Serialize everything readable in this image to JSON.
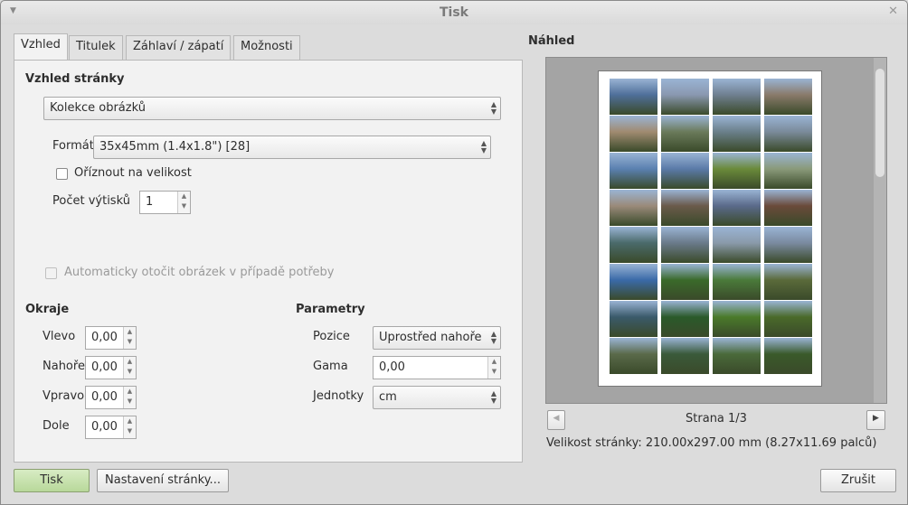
{
  "window": {
    "title": "Tisk"
  },
  "tabs": [
    {
      "label": "Vzhled"
    },
    {
      "label": "Titulek"
    },
    {
      "label": "Záhlaví / zápatí"
    },
    {
      "label": "Možnosti"
    }
  ],
  "layout": {
    "section_title": "Vzhled stránky",
    "layout_type": "Kolekce obrázků",
    "format_label": "Formát",
    "format_value": "35x45mm (1.4x1.8\") [28]",
    "crop_label": "Oříznout na velikost",
    "crop_checked": false,
    "copies_label": "Počet výtisků",
    "copies_value": "1",
    "autorotate_label": "Automaticky otočit obrázek v případě potřeby"
  },
  "margins": {
    "title": "Okraje",
    "items": [
      {
        "label": "Vlevo",
        "value": "0,00"
      },
      {
        "label": "Nahoře",
        "value": "0,00"
      },
      {
        "label": "Vpravo",
        "value": "0,00"
      },
      {
        "label": "Dole",
        "value": "0,00"
      }
    ]
  },
  "params": {
    "title": "Parametry",
    "position_label": "Pozice",
    "position_value": "Uprostřed nahoře",
    "gamma_label": "Gama",
    "gamma_value": "0,00",
    "units_label": "Jednotky",
    "units_value": "cm"
  },
  "preview": {
    "title": "Náhled",
    "page_label": "Strana 1/3",
    "page_size": "Velikost stránky: 210.00x297.00 mm (8.27x11.69 palců)",
    "thumb_colors": [
      "#4f6f9a",
      "#8a98b0",
      "#6f7f90",
      "#8a7a6a",
      "#a08a70",
      "#6a7a5a",
      "#6a7f8a",
      "#7a8a9a",
      "#5a80b0",
      "#5a7aa8",
      "#6a8a3a",
      "#8a9a7a",
      "#9a8a7a",
      "#6a5a4a",
      "#5a6a8a",
      "#6a4a3a",
      "#4a6a6a",
      "#6a7a8a",
      "#8a9aaa",
      "#7a8aa0",
      "#3a6aa8",
      "#3a6a2a",
      "#4a7a3a",
      "#5a6a3a",
      "#3a5a6a",
      "#2a5a2a",
      "#4a7a2a",
      "#4a6a2a",
      "#5a6a4a",
      "#3a5a3a",
      "#4a6a3a",
      "#3a5a2a"
    ]
  },
  "buttons": {
    "print": "Tisk",
    "page_setup": "Nastavení stránky...",
    "cancel": "Zrušit"
  }
}
